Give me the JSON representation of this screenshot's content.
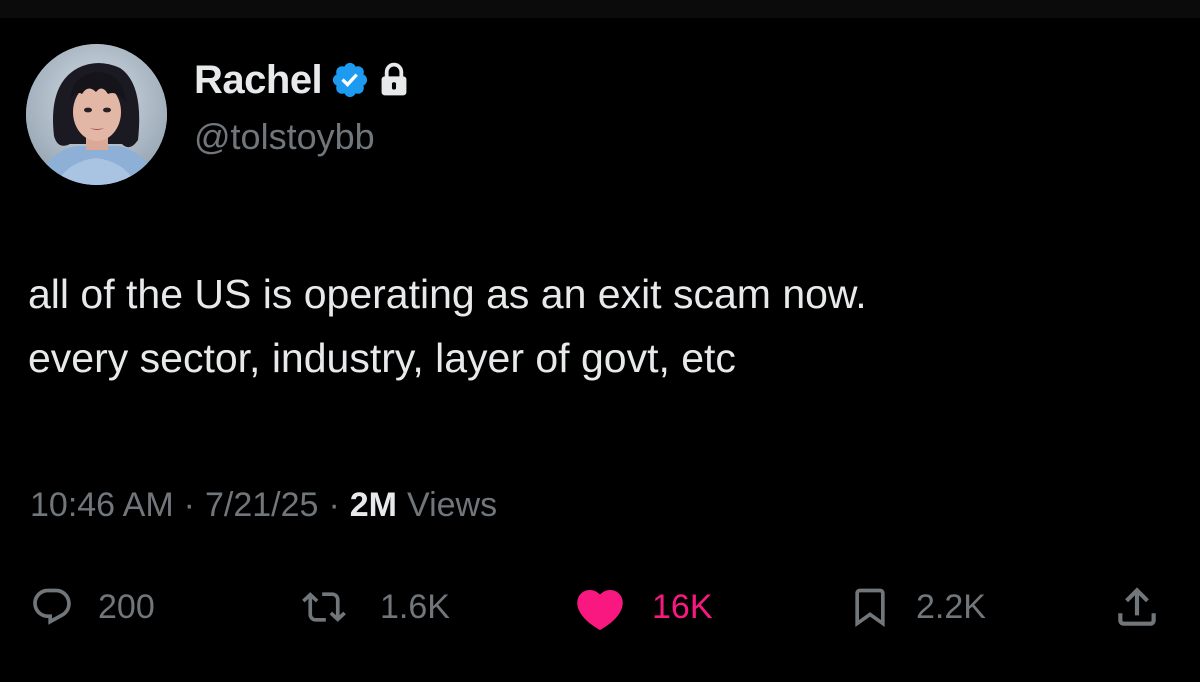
{
  "user": {
    "display_name": "Rachel",
    "handle": "@tolstoybb",
    "verified": true,
    "protected": true,
    "verified_color": "#1d9bf0"
  },
  "tweet": {
    "lines": [
      "all of the US is operating as an exit scam now.",
      "every sector, industry, layer of govt, etc"
    ]
  },
  "meta": {
    "time": "10:46 AM",
    "separator": "·",
    "date": "7/21/25",
    "views_count": "2M",
    "views_label": "Views"
  },
  "actions": {
    "reply": {
      "icon": "reply-icon",
      "count": "200"
    },
    "retweet": {
      "icon": "retweet-icon",
      "count": "1.6K"
    },
    "like": {
      "icon": "heart-icon",
      "count": "16K",
      "color": "#f91880"
    },
    "bookmark": {
      "icon": "bookmark-icon",
      "count": "2.2K"
    },
    "share": {
      "icon": "share-icon"
    }
  },
  "colors": {
    "background": "#000000",
    "primary_text": "#e7e9ea",
    "secondary_text": "#71767b"
  }
}
